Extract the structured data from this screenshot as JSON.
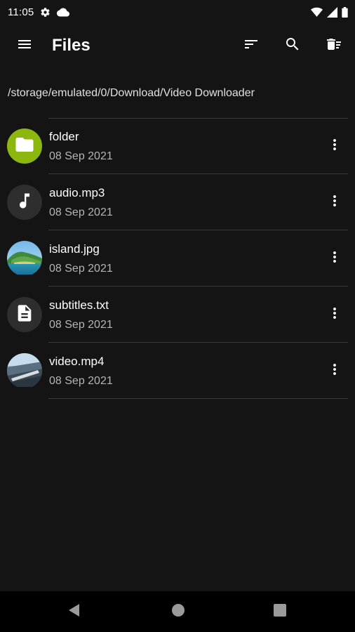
{
  "status_bar": {
    "time": "11:05",
    "left_icons": [
      "settings-icon",
      "cloud-icon"
    ],
    "right_icons": [
      "wifi-icon",
      "signal-icon",
      "battery-icon"
    ]
  },
  "app_bar": {
    "title": "Files",
    "icons": [
      "menu-icon",
      "sort-icon",
      "search-icon",
      "delete-icon"
    ]
  },
  "path": "/storage/emulated/0/Download/Video Downloader",
  "files": [
    {
      "name": "folder",
      "date": "08 Sep 2021",
      "type": "folder",
      "icon": "folder-icon",
      "color": "#8cb70f"
    },
    {
      "name": "audio.mp3",
      "date": "08 Sep 2021",
      "type": "audio",
      "icon": "music-note-icon",
      "color": "#2e2e2e"
    },
    {
      "name": "island.jpg",
      "date": "08 Sep 2021",
      "type": "image",
      "icon": "island-thumbnail",
      "color": "#3a8fc7"
    },
    {
      "name": "subtitles.txt",
      "date": "08 Sep 2021",
      "type": "text",
      "icon": "document-icon",
      "color": "#2e2e2e"
    },
    {
      "name": "video.mp4",
      "date": "08 Sep 2021",
      "type": "video",
      "icon": "video-thumbnail",
      "color": "#4a6a8a"
    }
  ],
  "nav_bar": {
    "icons": [
      "back-icon",
      "home-icon",
      "recents-icon"
    ]
  },
  "colors": {
    "background": "#141414",
    "divider": "#3a3a3a",
    "secondary_text": "#b5b5b5",
    "folder_accent": "#8cb70f"
  }
}
